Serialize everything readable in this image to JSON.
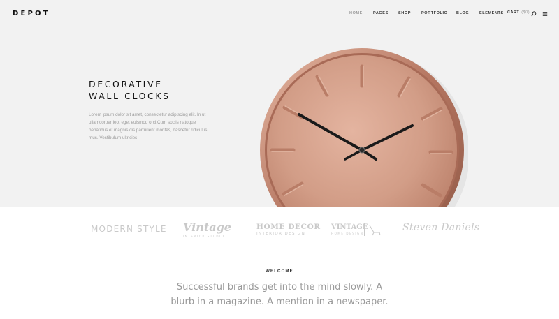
{
  "header": {
    "logo": "DEPOT",
    "nav": [
      {
        "label": "HOME",
        "active": true
      },
      {
        "label": "PAGES",
        "active": false
      },
      {
        "label": "SHOP",
        "active": false
      },
      {
        "label": "PORTFOLIO",
        "active": false
      },
      {
        "label": "BLOG",
        "active": false
      },
      {
        "label": "ELEMENTS",
        "active": false
      }
    ],
    "cart_label": "CART",
    "cart_count": "($0)",
    "search_icon": "search-icon",
    "menu_icon": "hamburger-menu-icon"
  },
  "hero": {
    "title_line1": "DECORATIVE",
    "title_line2": "WALL CLOCKS",
    "text": "Lorem ipsum dolor sit amet, consectetur adipiscing elit. In ut ullamcorper leo, eget euismod orci.Cum sociis natoque penatibus et magnis dis parturient montes, nascetur ridiculus mus. Vestibulum ultricies",
    "image": "copper-wall-clock"
  },
  "brands": {
    "modern": "MODERN STYLE",
    "vintage": "Vintage",
    "vintage_sub": "INTERIOR STUDIO",
    "homedecor": "HOME DECOR",
    "homedecor_sub": "INTERIOR DESIGN",
    "vintage2": "VINTAGE",
    "vintage2_sub": "HOME DESIGN",
    "steven": "Steven Daniels"
  },
  "welcome": {
    "label": "WELCOME",
    "text": "Successful brands get into the mind slowly. A blurb in a magazine. A mention in a newspaper."
  },
  "colors": {
    "background": "#f2f2f2",
    "copper": "#c8917b",
    "muted_text": "#9a9a9a"
  }
}
